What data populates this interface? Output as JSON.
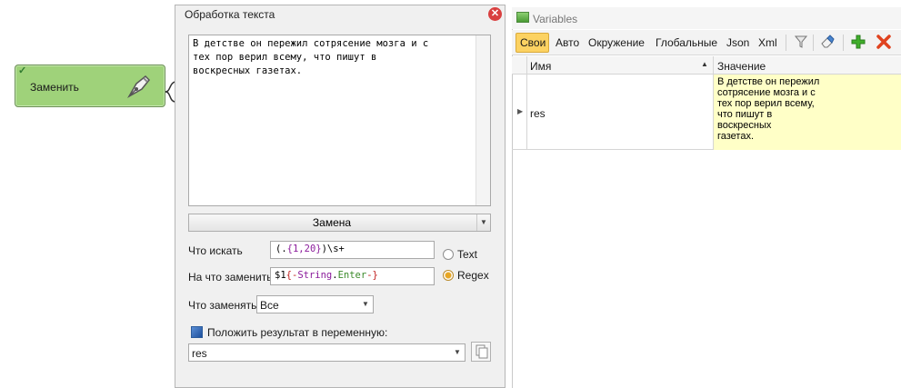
{
  "node": {
    "label": "Заменить",
    "check_icon": "check-icon",
    "tool_icon": "pen-nib-icon",
    "color": "#9fd27a"
  },
  "text_panel": {
    "title": "Обработка текста",
    "close_icon": "close-icon",
    "text_content": "В детстве он пережил сотрясение мозга и с\nтех пор верил всему, что пишут в\nвоскресных газетах.",
    "mode": "Замена",
    "find_label": "Что искать",
    "find_value": {
      "p1": "(.",
      "p2": "{1,20}",
      "p3": ")\\s+"
    },
    "replace_label": "На что заменить",
    "replace_value": {
      "p1": "$1",
      "p2": "{-",
      "p3": "String",
      "p4": ".",
      "p5": "Enter",
      "p6": "-}"
    },
    "radio_text": "Text",
    "radio_regex": "Regex",
    "selected_radio": "Regex",
    "scope_label": "Что заменять",
    "scope_value": "Все",
    "save_label": "Положить результат в переменную:",
    "save_checked": true,
    "variable": "res"
  },
  "variables_panel": {
    "title": "Variables",
    "tabs": [
      "Свои",
      "Авто",
      "Окружение",
      "Глобальные",
      "Json",
      "Xml"
    ],
    "active_tab": "Свои",
    "toolbar_icons": [
      "filter-icon",
      "eraser-icon",
      "add-icon",
      "delete-icon"
    ],
    "columns": {
      "name": "Имя",
      "value": "Значение"
    },
    "rows": [
      {
        "name": "res",
        "value": "В детстве он пережил\nсотрясение мозга и с\nтех пор верил всему,\nчто пишут в\nвоскресных\nгазетах."
      }
    ],
    "accent": "#fcd262"
  }
}
